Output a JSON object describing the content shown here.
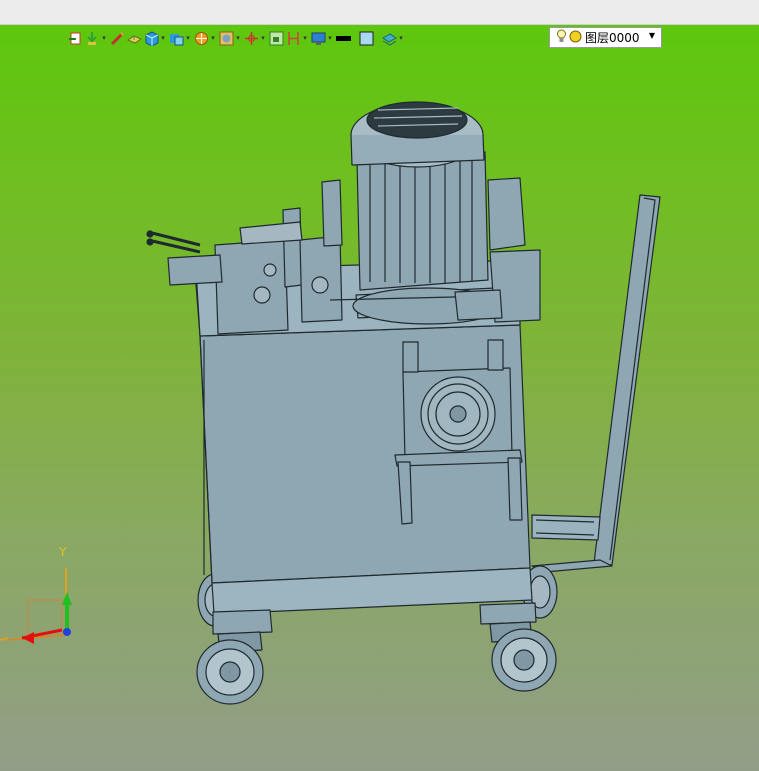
{
  "toolbar": {
    "layer_select_value": "图层0000",
    "tools": [
      {
        "icon": "snap-icon",
        "dropdown": false
      },
      {
        "icon": "selection-filter-icon",
        "dropdown": true
      },
      {
        "icon": "pencil-icon",
        "dropdown": false
      },
      {
        "icon": "view-plane-icon",
        "dropdown": false
      },
      {
        "icon": "view-cube-icon",
        "dropdown": true
      },
      {
        "icon": "render-style-icon",
        "dropdown": true
      },
      {
        "icon": "section-view-icon",
        "dropdown": true
      },
      {
        "icon": "display-mode-icon",
        "dropdown": true
      },
      {
        "icon": "origin-icon",
        "dropdown": true
      },
      {
        "icon": "plane-icon",
        "dropdown": false
      },
      {
        "icon": "dimension-icon",
        "dropdown": true
      },
      {
        "icon": "monitor-icon",
        "dropdown": true
      },
      {
        "icon": "line-color-icon",
        "dropdown": false
      },
      {
        "icon": "fill-color-icon",
        "dropdown": false
      },
      {
        "icon": "layer-icon",
        "dropdown": true
      }
    ]
  },
  "triad": {
    "y_label": "Y"
  },
  "colors": {
    "background_top": "#5dc70d",
    "background_bottom": "#929d88",
    "model_fill": "#8fa7b3",
    "model_edge": "#1f2a30",
    "axis_x": "#e01010",
    "axis_y": "#20c020",
    "axis_z": "#2040e0"
  }
}
